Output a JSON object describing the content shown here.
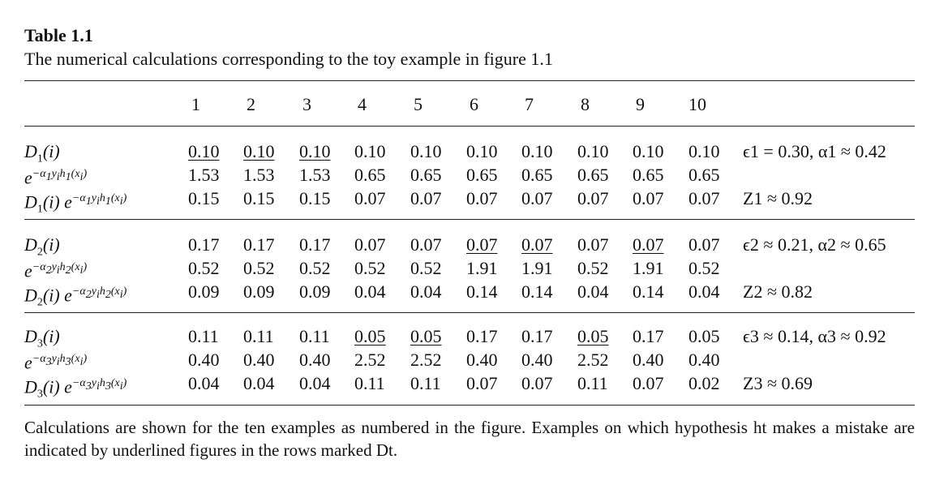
{
  "table": {
    "title": "Table 1.1",
    "caption": "The numerical calculations corresponding to the toy example in figure 1.1",
    "columns": [
      "1",
      "2",
      "3",
      "4",
      "5",
      "6",
      "7",
      "8",
      "9",
      "10"
    ],
    "rounds": [
      {
        "rows": [
          {
            "label": "D1(i)",
            "values": [
              "0.10",
              "0.10",
              "0.10",
              "0.10",
              "0.10",
              "0.10",
              "0.10",
              "0.10",
              "0.10",
              "0.10"
            ],
            "underlined": [
              true,
              true,
              true,
              false,
              false,
              false,
              false,
              false,
              false,
              false
            ]
          },
          {
            "label": "e^{−α1 yi h1(xi)}",
            "values": [
              "1.53",
              "1.53",
              "1.53",
              "0.65",
              "0.65",
              "0.65",
              "0.65",
              "0.65",
              "0.65",
              "0.65"
            ],
            "underlined": [
              false,
              false,
              false,
              false,
              false,
              false,
              false,
              false,
              false,
              false
            ]
          },
          {
            "label": "D1(i) e^{−α1 yi h1(xi)}",
            "values": [
              "0.15",
              "0.15",
              "0.15",
              "0.07",
              "0.07",
              "0.07",
              "0.07",
              "0.07",
              "0.07",
              "0.07"
            ],
            "underlined": [
              false,
              false,
              false,
              false,
              false,
              false,
              false,
              false,
              false,
              false
            ]
          }
        ],
        "summary_top": "ϵ1 = 0.30, α1 ≈ 0.42",
        "summary_bottom": "Z1 ≈ 0.92"
      },
      {
        "rows": [
          {
            "label": "D2(i)",
            "values": [
              "0.17",
              "0.17",
              "0.17",
              "0.07",
              "0.07",
              "0.07",
              "0.07",
              "0.07",
              "0.07",
              "0.07"
            ],
            "underlined": [
              false,
              false,
              false,
              false,
              false,
              true,
              true,
              false,
              true,
              false
            ]
          },
          {
            "label": "e^{−α2 yi h2(xi)}",
            "values": [
              "0.52",
              "0.52",
              "0.52",
              "0.52",
              "0.52",
              "1.91",
              "1.91",
              "0.52",
              "1.91",
              "0.52"
            ],
            "underlined": [
              false,
              false,
              false,
              false,
              false,
              false,
              false,
              false,
              false,
              false
            ]
          },
          {
            "label": "D2(i) e^{−α2 yi h2(xi)}",
            "values": [
              "0.09",
              "0.09",
              "0.09",
              "0.04",
              "0.04",
              "0.14",
              "0.14",
              "0.04",
              "0.14",
              "0.04"
            ],
            "underlined": [
              false,
              false,
              false,
              false,
              false,
              false,
              false,
              false,
              false,
              false
            ]
          }
        ],
        "summary_top": "ϵ2 ≈ 0.21, α2 ≈ 0.65",
        "summary_bottom": "Z2 ≈ 0.82"
      },
      {
        "rows": [
          {
            "label": "D3(i)",
            "values": [
              "0.11",
              "0.11",
              "0.11",
              "0.05",
              "0.05",
              "0.17",
              "0.17",
              "0.05",
              "0.17",
              "0.05"
            ],
            "underlined": [
              false,
              false,
              false,
              true,
              true,
              false,
              false,
              true,
              false,
              false
            ]
          },
          {
            "label": "e^{−α3 yi h3(xi)}",
            "values": [
              "0.40",
              "0.40",
              "0.40",
              "2.52",
              "2.52",
              "0.40",
              "0.40",
              "2.52",
              "0.40",
              "0.40"
            ],
            "underlined": [
              false,
              false,
              false,
              false,
              false,
              false,
              false,
              false,
              false,
              false
            ]
          },
          {
            "label": "D3(i) e^{−α3 yi h3(xi)}",
            "values": [
              "0.04",
              "0.04",
              "0.04",
              "0.11",
              "0.11",
              "0.07",
              "0.07",
              "0.11",
              "0.07",
              "0.02"
            ],
            "underlined": [
              false,
              false,
              false,
              false,
              false,
              false,
              false,
              false,
              false,
              false
            ]
          }
        ],
        "summary_top": "ϵ3 ≈ 0.14, α3 ≈ 0.92",
        "summary_bottom": "Z3 ≈ 0.69"
      }
    ],
    "footnote": "Calculations are shown for the ten examples as numbered in the figure. Examples on which hypothesis ht makes a mistake are indicated by underlined figures in the rows marked Dt."
  }
}
